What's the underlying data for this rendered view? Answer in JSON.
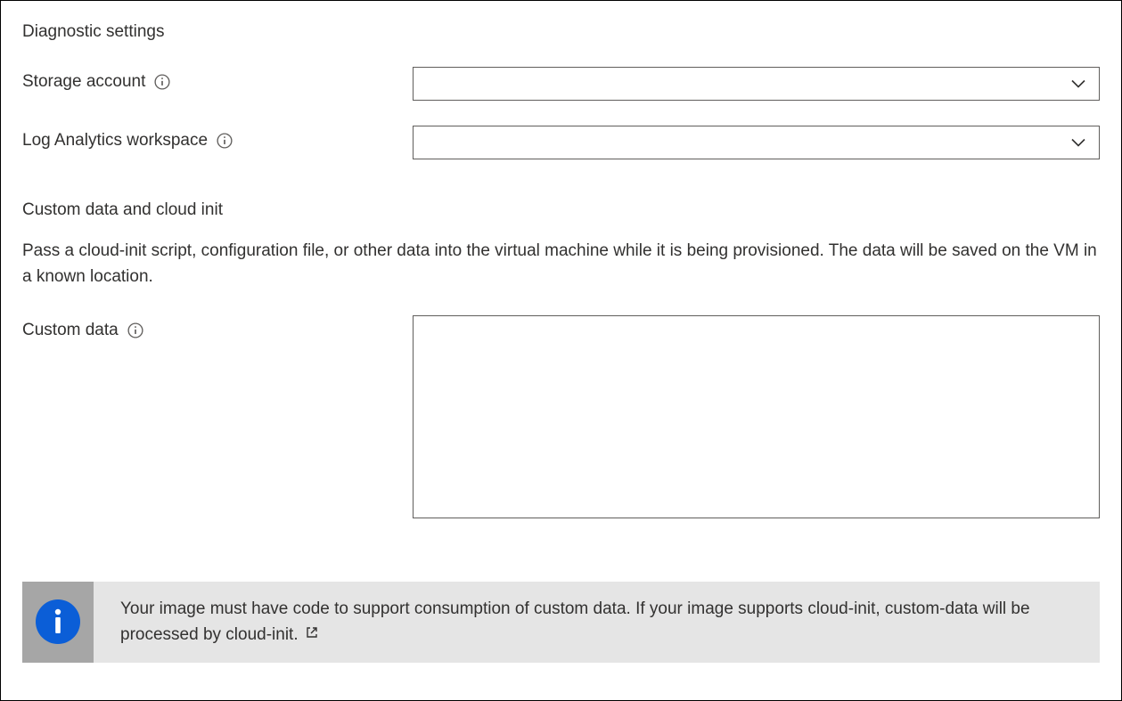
{
  "diagnostic": {
    "heading": "Diagnostic settings",
    "storage_account_label": "Storage account",
    "storage_account_value": "",
    "log_analytics_label": "Log Analytics workspace",
    "log_analytics_value": ""
  },
  "custom_data": {
    "heading": "Custom data and cloud init",
    "description": "Pass a cloud-init script, configuration file, or other data into the virtual machine while it is being provisioned. The data will be saved on the VM in a known location.",
    "custom_data_label": "Custom data",
    "custom_data_value": ""
  },
  "info_banner": {
    "text": "Your image must have code to support consumption of custom data. If your image supports cloud-init, custom-data will be processed by cloud-init."
  }
}
